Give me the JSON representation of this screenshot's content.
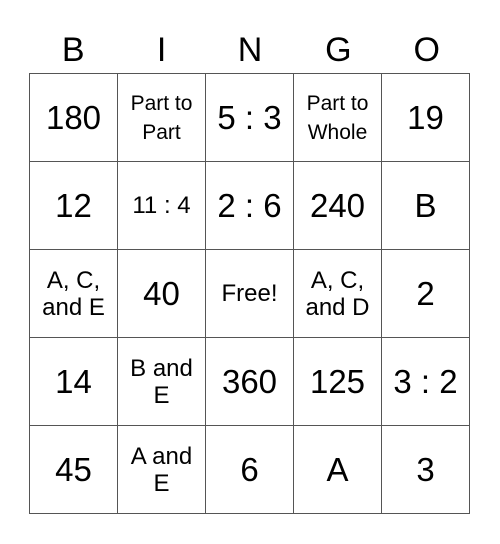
{
  "header": {
    "letters": [
      "B",
      "I",
      "N",
      "G",
      "O"
    ]
  },
  "card": {
    "rows": [
      [
        {
          "text": "180",
          "size": "big"
        },
        {
          "text": "Part to Part",
          "size": "sm"
        },
        {
          "text": "5 : 3",
          "size": "big"
        },
        {
          "text": "Part to Whole",
          "size": "sm"
        },
        {
          "text": "19",
          "size": "big"
        }
      ],
      [
        {
          "text": "12",
          "size": "big"
        },
        {
          "text": "11 : 4",
          "size": "med"
        },
        {
          "text": "2 : 6",
          "size": "big"
        },
        {
          "text": "240",
          "size": "big"
        },
        {
          "text": "B",
          "size": "big"
        }
      ],
      [
        {
          "text": "A, C, and E",
          "size": "med"
        },
        {
          "text": "40",
          "size": "big"
        },
        {
          "text": "Free!",
          "size": "med"
        },
        {
          "text": "A, C, and D",
          "size": "med"
        },
        {
          "text": "2",
          "size": "big"
        }
      ],
      [
        {
          "text": "14",
          "size": "big"
        },
        {
          "text": "B and E",
          "size": "med"
        },
        {
          "text": "360",
          "size": "big"
        },
        {
          "text": "125",
          "size": "big"
        },
        {
          "text": "3 : 2",
          "size": "big"
        }
      ],
      [
        {
          "text": "45",
          "size": "big"
        },
        {
          "text": "A and E",
          "size": "med"
        },
        {
          "text": "6",
          "size": "big"
        },
        {
          "text": "A",
          "size": "big"
        },
        {
          "text": "3",
          "size": "big"
        }
      ]
    ]
  }
}
